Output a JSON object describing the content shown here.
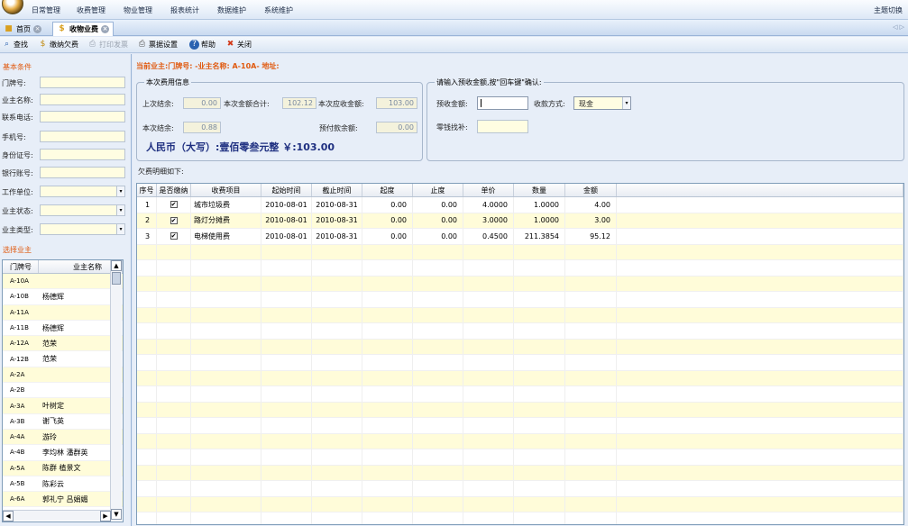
{
  "menu": {
    "items": [
      "日常管理",
      "收费管理",
      "物业管理",
      "报表统计",
      "数据维护",
      "系统维护"
    ],
    "theme_switch": "主题切换"
  },
  "tabs": {
    "home": "首页",
    "active": "收物业费"
  },
  "toolbar": {
    "find": "查找",
    "pay_arrears": "缴纳欠费",
    "print_invoice": "打印发票",
    "receipt_settings": "票据设置",
    "help": "帮助",
    "close": "关闭"
  },
  "filter": {
    "title": "基本条件",
    "fields": {
      "door_no": "门牌号:",
      "owner_name": "业主名称:",
      "phone": "联系电话:",
      "mobile": "手机号:",
      "id_no": "身份证号:",
      "bank_account": "银行账号:",
      "work_unit": "工作单位:",
      "owner_status": "业主状态:",
      "owner_type": "业主类型:"
    }
  },
  "owners": {
    "title": "选择业主",
    "col_door": "门牌号",
    "col_name": "业主名称",
    "rows": [
      {
        "door": "A-10A",
        "name": ""
      },
      {
        "door": "A-10B",
        "name": "杨德辉"
      },
      {
        "door": "A-11A",
        "name": ""
      },
      {
        "door": "A-11B",
        "name": "杨德辉"
      },
      {
        "door": "A-12A",
        "name": "范荣"
      },
      {
        "door": "A-12B",
        "name": "范荣"
      },
      {
        "door": "A-2A",
        "name": ""
      },
      {
        "door": "A-2B",
        "name": ""
      },
      {
        "door": "A-3A",
        "name": "叶树定"
      },
      {
        "door": "A-3B",
        "name": "谢飞英"
      },
      {
        "door": "A-4A",
        "name": "游玲"
      },
      {
        "door": "A-4B",
        "name": "李均林 潘群英"
      },
      {
        "door": "A-5A",
        "name": "陈群 植景文"
      },
      {
        "door": "A-5B",
        "name": "陈彩云"
      },
      {
        "door": "A-6A",
        "name": "郭礼宁 吕娟媚"
      }
    ]
  },
  "current_owner": "当前业主:门牌号: -业主名称: A-10A- 地址:",
  "fee_info": {
    "title": "本次费用信息",
    "last_balance_label": "上次结余:",
    "last_balance": "0.00",
    "total_label": "本次金额合计:",
    "total": "102.12",
    "receivable_label": "本次应收金额:",
    "receivable": "103.00",
    "this_balance_label": "本次结余:",
    "this_balance": "0.88",
    "prepaid_label": "预付款余额:",
    "prepaid": "0.00",
    "amount_in_words": "人民币（大写）:壹佰零叁元整  ￥:103.00"
  },
  "payment": {
    "title": "请输入预收金额,按\"回车键\"确认:",
    "prepay_label": "预收金额:",
    "prepay_value": "",
    "method_label": "收款方式:",
    "method_value": "现金",
    "change_label": "零钱找补:",
    "change_value": ""
  },
  "arrears": {
    "label": "欠费明细如下:",
    "columns": [
      "序号",
      "是否缴纳",
      "收费项目",
      "起始时间",
      "截止时间",
      "起度",
      "止度",
      "单价",
      "数量",
      "金额"
    ],
    "rows": [
      {
        "no": "1",
        "paid": "✔",
        "item": "城市垃圾费",
        "start": "2010-08-01",
        "end": "2010-08-31",
        "from": "0.00",
        "to": "0.00",
        "price": "4.0000",
        "qty": "1.0000",
        "amount": "4.00"
      },
      {
        "no": "2",
        "paid": "✔",
        "item": "路灯分摊费",
        "start": "2010-08-01",
        "end": "2010-08-31",
        "from": "0.00",
        "to": "0.00",
        "price": "3.0000",
        "qty": "1.0000",
        "amount": "3.00"
      },
      {
        "no": "3",
        "paid": "✔",
        "item": "电梯使用费",
        "start": "2010-08-01",
        "end": "2010-08-31",
        "from": "0.00",
        "to": "0.00",
        "price": "0.4500",
        "qty": "211.3854",
        "amount": "95.12"
      }
    ]
  }
}
